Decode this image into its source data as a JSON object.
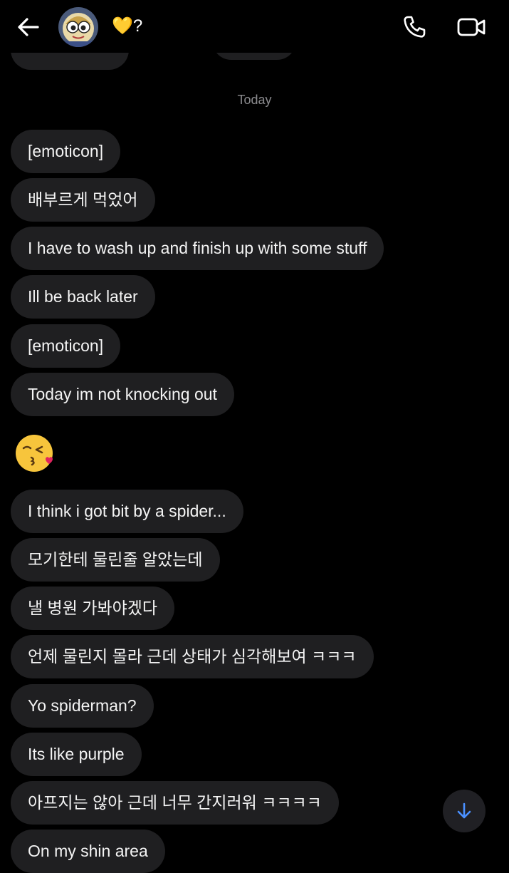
{
  "header": {
    "contact_name": "💛?",
    "icons": {
      "back": "arrow-left-icon",
      "call": "phone-icon",
      "video": "video-camera-icon"
    }
  },
  "date_separator": "Today",
  "messages": [
    {
      "text": "[emoticon]"
    },
    {
      "text": "배부르게 먹었어"
    },
    {
      "text": "I have to wash up and finish up with some stuff"
    },
    {
      "text": "Ill be back later"
    },
    {
      "text": "[emoticon]"
    },
    {
      "text": "Today im not knocking out"
    },
    {
      "emoji": "😘"
    },
    {
      "text": "I think i got bit by a spider..."
    },
    {
      "text": "모기한테 물린줄 알았는데"
    },
    {
      "text": "낼 병원 가봐야겠다"
    },
    {
      "text": "언제 물린지 몰라 근데 상태가 심각해보여 ㅋㅋㅋ"
    },
    {
      "text": "Yo spiderman?"
    },
    {
      "text": "Its like purple"
    },
    {
      "text": "아프지는 않아 근데 너무 간지러워 ㅋㅋㅋㅋ"
    },
    {
      "text": "On my shin area"
    }
  ],
  "colors": {
    "background": "#000000",
    "bubble": "#1f1f21",
    "text": "#f4f4f4",
    "muted": "#8b8b8e",
    "accent": "#4a90ff"
  },
  "scroll_button_icon": "arrow-down-icon"
}
